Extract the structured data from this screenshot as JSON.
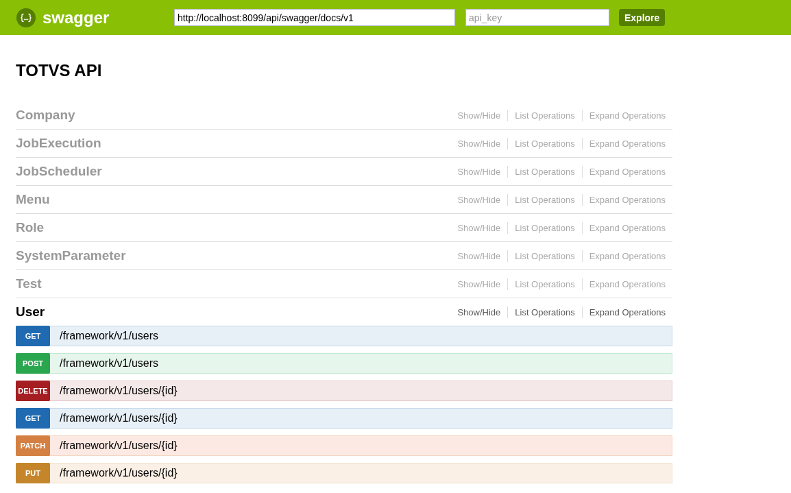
{
  "header": {
    "logo_text": "swagger",
    "url_field": {
      "value": "http://localhost:8099/api/swagger/docs/v1"
    },
    "api_key_field": {
      "placeholder": "api_key"
    },
    "button": "Explore"
  },
  "title": "TOTVS API",
  "resources": [
    {
      "name": "Company",
      "expanded": false,
      "actions": [
        "Show/Hide",
        "List Operations",
        "Expand Operations"
      ]
    },
    {
      "name": "JobExecution",
      "expanded": false,
      "actions": [
        "Show/Hide",
        "List Operations",
        "Expand Operations"
      ]
    },
    {
      "name": "JobScheduler",
      "expanded": false,
      "actions": [
        "Show/Hide",
        "List Operations",
        "Expand Operations"
      ]
    },
    {
      "name": "Menu",
      "expanded": false,
      "actions": [
        "Show/Hide",
        "List Operations",
        "Expand Operations"
      ]
    },
    {
      "name": "Role",
      "expanded": false,
      "actions": [
        "Show/Hide",
        "List Operations",
        "Expand Operations"
      ]
    },
    {
      "name": "SystemParameter",
      "expanded": false,
      "actions": [
        "Show/Hide",
        "List Operations",
        "Expand Operations"
      ]
    },
    {
      "name": "Test",
      "expanded": false,
      "actions": [
        "Show/Hide",
        "List Operations",
        "Expand Operations"
      ]
    },
    {
      "name": "User",
      "expanded": true,
      "actions": [
        "Show/Hide",
        "List Operations",
        "Expand Operations"
      ],
      "operations": [
        {
          "kind": "get",
          "method": "GET",
          "path": "/framework/v1/users"
        },
        {
          "kind": "post",
          "method": "POST",
          "path": "/framework/v1/users"
        },
        {
          "kind": "delete",
          "method": "DELETE",
          "path": "/framework/v1/users/{id}"
        },
        {
          "kind": "get",
          "method": "GET",
          "path": "/framework/v1/users/{id}"
        },
        {
          "kind": "patch",
          "method": "PATCH",
          "path": "/framework/v1/users/{id}"
        },
        {
          "kind": "put",
          "method": "PUT",
          "path": "/framework/v1/users/{id}"
        }
      ]
    }
  ]
}
